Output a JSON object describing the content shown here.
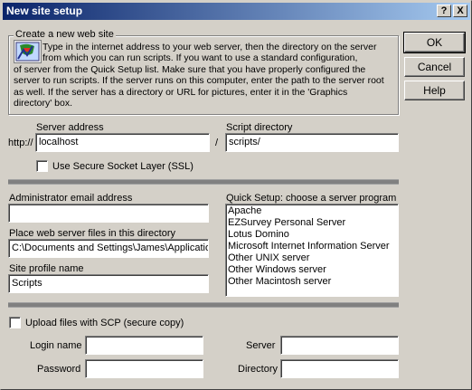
{
  "window": {
    "title": "New site setup",
    "help_btn": "?",
    "close_btn": "X"
  },
  "buttons": {
    "ok": "OK",
    "cancel": "Cancel",
    "help": "Help"
  },
  "create_group": {
    "legend": "Create a new web site",
    "desc_lines": [
      "Type in the internet address to your web server, then the directory on the server",
      "from which you can run scripts. If you want to use a standard configuration,",
      "of server from the Quick Setup list. Make sure that you have properly configured the",
      "server to run scripts. If the server runs on this computer, enter the path to the server root",
      "as well. If the server has a directory or URL for pictures, enter it in the 'Graphics",
      "directory' box."
    ]
  },
  "server": {
    "address_label": "Server address",
    "prefix": "http://",
    "address_value": "localhost",
    "slash": "/",
    "script_dir_label": "Script directory",
    "script_dir_value": "scripts/",
    "ssl_label": "Use Secure Socket Layer (SSL)"
  },
  "left": {
    "admin_email_label": "Administrator email address",
    "admin_email_value": "",
    "place_files_label": "Place web server files in this directory",
    "place_files_value": "C:\\Documents and Settings\\James\\Applicatio",
    "profile_label": "Site profile name",
    "profile_value": "Scripts"
  },
  "quick_setup": {
    "label": "Quick Setup: choose a server program",
    "items": [
      "Apache",
      "EZSurvey Personal Server",
      "Lotus Domino",
      "Microsoft Internet Information Server",
      "Other UNIX server",
      "Other Windows server",
      "Other Macintosh server"
    ]
  },
  "scp": {
    "upload_label": "Upload files with SCP (secure copy)",
    "login_label": "Login name",
    "login_value": "",
    "password_label": "Password",
    "password_value": "",
    "server_label": "Server",
    "server_value": "",
    "directory_label": "Directory",
    "directory_value": ""
  }
}
